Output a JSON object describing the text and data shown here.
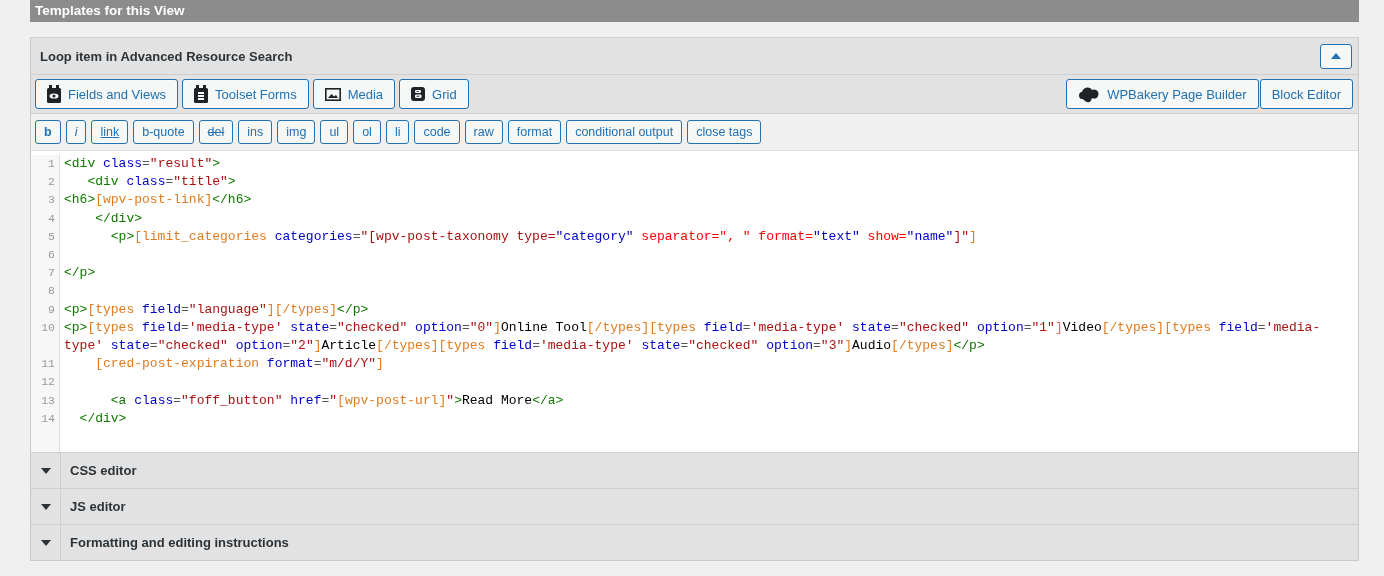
{
  "section_title": "Templates for this View",
  "panel": {
    "title": "Loop item in Advanced Resource Search",
    "expanded": true,
    "left_buttons": [
      {
        "label": "Fields and Views"
      },
      {
        "label": "Toolset Forms"
      },
      {
        "label": "Media"
      },
      {
        "label": "Grid"
      }
    ],
    "right_buttons": [
      {
        "label": "WPBakery Page Builder"
      },
      {
        "label": "Block Editor"
      }
    ],
    "quicktags": [
      {
        "label": "b",
        "kind": "bold"
      },
      {
        "label": "i",
        "kind": "italic"
      },
      {
        "label": "link",
        "kind": "underline"
      },
      {
        "label": "b-quote",
        "kind": "plain"
      },
      {
        "label": "del",
        "kind": "strike"
      },
      {
        "label": "ins",
        "kind": "plain"
      },
      {
        "label": "img",
        "kind": "plain"
      },
      {
        "label": "ul",
        "kind": "plain"
      },
      {
        "label": "ol",
        "kind": "plain"
      },
      {
        "label": "li",
        "kind": "plain"
      },
      {
        "label": "code",
        "kind": "plain"
      },
      {
        "label": "raw",
        "kind": "plain"
      },
      {
        "label": "format",
        "kind": "plain"
      },
      {
        "label": "conditional output",
        "kind": "plain"
      },
      {
        "label": "close tags",
        "kind": "plain"
      }
    ],
    "code_lines": [
      {
        "number": "1",
        "tokens": [
          {
            "kind": "tag",
            "text": "<div"
          },
          {
            "kind": "attr",
            "text": " class"
          },
          {
            "kind": "eq",
            "text": "="
          },
          {
            "kind": "str",
            "text": "\"result\""
          },
          {
            "kind": "tag",
            "text": ">"
          }
        ]
      },
      {
        "number": "2",
        "tokens": [
          {
            "kind": "tag",
            "text": "   <div"
          },
          {
            "kind": "attr",
            "text": " class"
          },
          {
            "kind": "eq",
            "text": "="
          },
          {
            "kind": "str",
            "text": "\"title\""
          },
          {
            "kind": "tag",
            "text": ">"
          }
        ]
      },
      {
        "number": "3",
        "tokens": [
          {
            "kind": "tag",
            "text": "<h6>"
          },
          {
            "kind": "sc",
            "text": "[wpv-post-link]"
          },
          {
            "kind": "tag",
            "text": "</h6>"
          }
        ]
      },
      {
        "number": "4",
        "tokens": [
          {
            "kind": "tag",
            "text": "    </div>"
          }
        ]
      },
      {
        "number": "5",
        "tokens": [
          {
            "kind": "tag",
            "text": "      <p>"
          },
          {
            "kind": "sc",
            "text": "[limit_categories"
          },
          {
            "kind": "attr",
            "text": " categories"
          },
          {
            "kind": "eq",
            "text": "="
          },
          {
            "kind": "str",
            "text": "\"[wpv-post-taxonomy type="
          },
          {
            "kind": "attr",
            "text": "\"category\""
          },
          {
            "kind": "err",
            "text": " separator=\", \" format="
          },
          {
            "kind": "attr",
            "text": "\"text\""
          },
          {
            "kind": "err",
            "text": " show="
          },
          {
            "kind": "attr",
            "text": "\"name\""
          },
          {
            "kind": "str",
            "text": "]\""
          },
          {
            "kind": "sc",
            "text": "]"
          }
        ]
      },
      {
        "number": "6"
      },
      {
        "number": "7",
        "tokens": [
          {
            "kind": "tag",
            "text": "</p>"
          }
        ]
      },
      {
        "number": "8"
      },
      {
        "number": "9",
        "tokens": [
          {
            "kind": "tag",
            "text": "<p>"
          },
          {
            "kind": "sc",
            "text": "[types"
          },
          {
            "kind": "attr",
            "text": " field"
          },
          {
            "kind": "eq",
            "text": "="
          },
          {
            "kind": "str",
            "text": "\"language\""
          },
          {
            "kind": "sc",
            "text": "][/types]"
          },
          {
            "kind": "tag",
            "text": "</p>"
          }
        ]
      },
      {
        "number": "10",
        "tokens": [
          {
            "kind": "tag",
            "text": "<p>"
          },
          {
            "kind": "sc",
            "text": "[types"
          },
          {
            "kind": "attr",
            "text": " field"
          },
          {
            "kind": "eq",
            "text": "="
          },
          {
            "kind": "str",
            "text": "'media-type'"
          },
          {
            "kind": "attr",
            "text": " state"
          },
          {
            "kind": "eq",
            "text": "="
          },
          {
            "kind": "str",
            "text": "\"checked\""
          },
          {
            "kind": "attr",
            "text": " option"
          },
          {
            "kind": "eq",
            "text": "="
          },
          {
            "kind": "str",
            "text": "\"0\""
          },
          {
            "kind": "sc",
            "text": "]"
          },
          {
            "kind": "text",
            "text": "Online Tool"
          },
          {
            "kind": "sc",
            "text": "[/types][types"
          },
          {
            "kind": "attr",
            "text": " field"
          },
          {
            "kind": "eq",
            "text": "="
          },
          {
            "kind": "str",
            "text": "'media-type'"
          },
          {
            "kind": "attr",
            "text": " state"
          },
          {
            "kind": "eq",
            "text": "="
          },
          {
            "kind": "str",
            "text": "\"checked\""
          },
          {
            "kind": "attr",
            "text": " option"
          },
          {
            "kind": "eq",
            "text": "="
          },
          {
            "kind": "str",
            "text": "\"1\""
          },
          {
            "kind": "sc",
            "text": "]"
          },
          {
            "kind": "text",
            "text": "Video"
          },
          {
            "kind": "sc",
            "text": "[/types][types"
          },
          {
            "kind": "attr",
            "text": " field"
          },
          {
            "kind": "eq",
            "text": "="
          },
          {
            "kind": "str",
            "text": "'media-type'"
          },
          {
            "kind": "attr",
            "text": " state"
          },
          {
            "kind": "eq",
            "text": "="
          },
          {
            "kind": "str",
            "text": "\"checked\""
          },
          {
            "kind": "attr",
            "text": " option"
          },
          {
            "kind": "eq",
            "text": "="
          },
          {
            "kind": "str",
            "text": "\"2\""
          },
          {
            "kind": "sc",
            "text": "]"
          },
          {
            "kind": "text",
            "text": "Article"
          },
          {
            "kind": "sc",
            "text": "[/types][types"
          },
          {
            "kind": "attr",
            "text": " field"
          },
          {
            "kind": "eq",
            "text": "="
          },
          {
            "kind": "str",
            "text": "'media-type'"
          },
          {
            "kind": "attr",
            "text": " state"
          },
          {
            "kind": "eq",
            "text": "="
          },
          {
            "kind": "str",
            "text": "\"checked\""
          },
          {
            "kind": "attr",
            "text": " option"
          },
          {
            "kind": "eq",
            "text": "="
          },
          {
            "kind": "str",
            "text": "\"3\""
          },
          {
            "kind": "sc",
            "text": "]"
          },
          {
            "kind": "text",
            "text": "Audio"
          },
          {
            "kind": "sc",
            "text": "[/types]"
          },
          {
            "kind": "tag",
            "text": "</p>"
          }
        ]
      },
      {
        "number": "11",
        "tokens": [
          {
            "kind": "sc",
            "text": "    [cred-post-expiration"
          },
          {
            "kind": "attr",
            "text": " format"
          },
          {
            "kind": "eq",
            "text": "="
          },
          {
            "kind": "str",
            "text": "\"m/d/Y\""
          },
          {
            "kind": "sc",
            "text": "]"
          }
        ]
      },
      {
        "number": "12"
      },
      {
        "number": "13",
        "tokens": [
          {
            "kind": "tag",
            "text": "      <a"
          },
          {
            "kind": "attr",
            "text": " class"
          },
          {
            "kind": "eq",
            "text": "="
          },
          {
            "kind": "str",
            "text": "\"foff_button\""
          },
          {
            "kind": "attr",
            "text": " href"
          },
          {
            "kind": "eq",
            "text": "="
          },
          {
            "kind": "str",
            "text": "\""
          },
          {
            "kind": "sc",
            "text": "[wpv-post-url]"
          },
          {
            "kind": "str",
            "text": "\""
          },
          {
            "kind": "tag",
            "text": ">"
          },
          {
            "kind": "text",
            "text": "Read More"
          },
          {
            "kind": "tag",
            "text": "</a>"
          }
        ]
      },
      {
        "number": "14",
        "tokens": [
          {
            "kind": "tag",
            "text": "  </div>"
          }
        ]
      }
    ]
  },
  "sections": [
    {
      "title": "CSS editor",
      "expanded": false
    },
    {
      "title": "JS editor",
      "expanded": false
    },
    {
      "title": "Formatting and editing instructions",
      "expanded": false
    }
  ]
}
